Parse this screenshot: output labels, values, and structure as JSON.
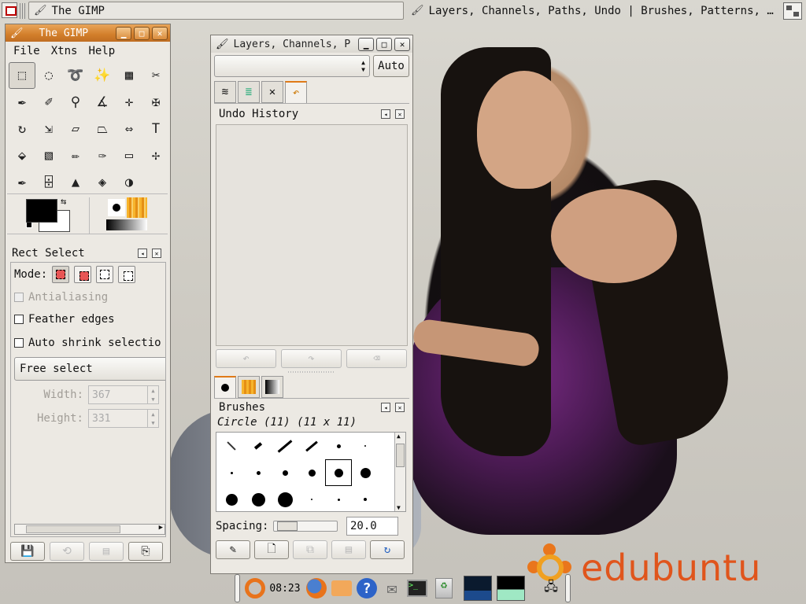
{
  "topbar": {
    "task1": "The GIMP",
    "task2": "Layers, Channels, Paths, Undo | Brushes, Patterns, …"
  },
  "toolbox": {
    "title": "The GIMP",
    "menu": [
      "File",
      "Xtns",
      "Help"
    ],
    "tools": [
      {
        "name": "rect-select-icon",
        "glyph": "⬚"
      },
      {
        "name": "ellipse-select-icon",
        "glyph": "◌"
      },
      {
        "name": "lasso-icon",
        "glyph": "➰"
      },
      {
        "name": "fuzzy-select-icon",
        "glyph": "✨"
      },
      {
        "name": "select-by-color-icon",
        "glyph": "▩"
      },
      {
        "name": "scissors-icon",
        "glyph": "✂"
      },
      {
        "name": "paths-icon",
        "glyph": "✒"
      },
      {
        "name": "color-picker-icon",
        "glyph": "✐"
      },
      {
        "name": "zoom-icon",
        "glyph": "⚲"
      },
      {
        "name": "measure-icon",
        "glyph": "∡"
      },
      {
        "name": "move-icon",
        "glyph": "✛"
      },
      {
        "name": "crop-icon",
        "glyph": "✠"
      },
      {
        "name": "rotate-icon",
        "glyph": "↻"
      },
      {
        "name": "scale-icon",
        "glyph": "⇲"
      },
      {
        "name": "shear-icon",
        "glyph": "▱"
      },
      {
        "name": "perspective-icon",
        "glyph": "⏢"
      },
      {
        "name": "flip-icon",
        "glyph": "⇔"
      },
      {
        "name": "text-icon",
        "glyph": "T"
      },
      {
        "name": "bucket-fill-icon",
        "glyph": "⬙"
      },
      {
        "name": "blend-icon",
        "glyph": "▧"
      },
      {
        "name": "pencil-icon",
        "glyph": "✏"
      },
      {
        "name": "paintbrush-icon",
        "glyph": "✑"
      },
      {
        "name": "eraser-icon",
        "glyph": "▭"
      },
      {
        "name": "airbrush-icon",
        "glyph": "✢"
      },
      {
        "name": "ink-icon",
        "glyph": "✒"
      },
      {
        "name": "clone-icon",
        "glyph": "⌹"
      },
      {
        "name": "heal-icon",
        "glyph": "▲"
      },
      {
        "name": "convolve-icon",
        "glyph": "◈"
      },
      {
        "name": "dodge-burn-icon",
        "glyph": "◑"
      },
      {
        "name": "smudge-icon",
        "glyph": ""
      }
    ],
    "tool_options": {
      "title": "Rect Select",
      "mode_label": "Mode:",
      "antialiasing": "Antialiasing",
      "feather_edges": "Feather edges",
      "auto_shrink": "Auto shrink selectio",
      "combo": "Free select",
      "width_label": "Width:",
      "width_value": "367",
      "height_label": "Height:",
      "height_value": "331"
    }
  },
  "dock": {
    "title": "Layers, Channels, P",
    "auto_button": "Auto",
    "undo_title": "Undo History",
    "brushes_title": "Brushes",
    "brush_name": "Circle (11) (11 x 11)",
    "spacing_label": "Spacing:",
    "spacing_value": "20.0"
  },
  "panel": {
    "clock": "08:23"
  },
  "brand": {
    "text": "edubuntu"
  },
  "colors": {
    "accent": "#d27e2a",
    "brand": "#e0551c"
  }
}
